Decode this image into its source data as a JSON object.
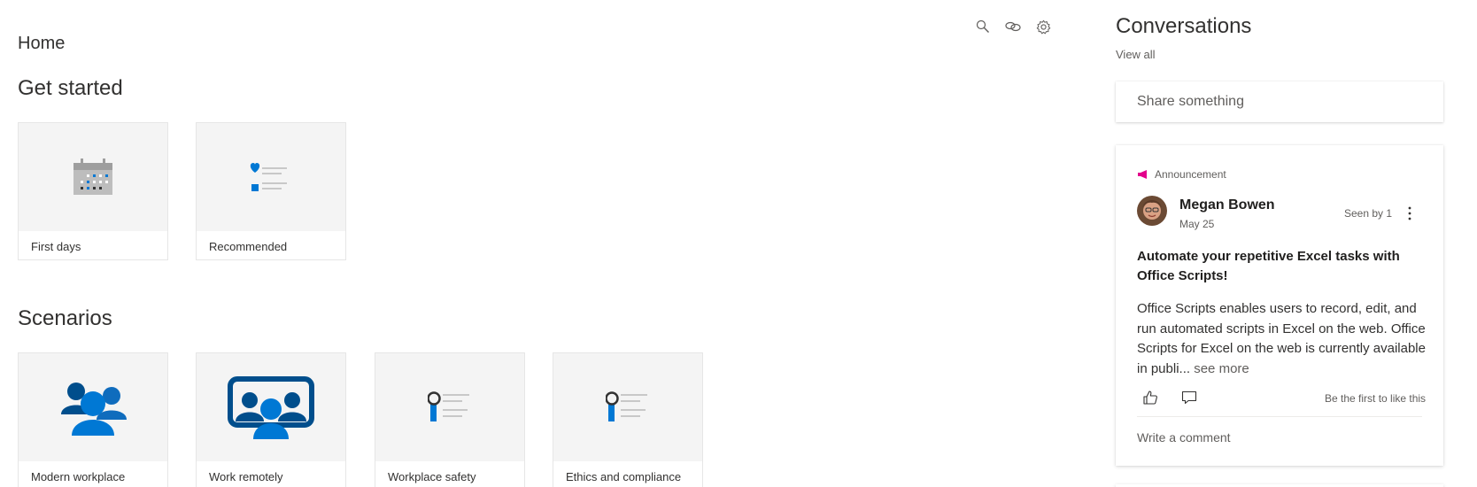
{
  "page": {
    "title": "Home"
  },
  "toolbar": {
    "icons": [
      "search-icon",
      "link-icon",
      "settings-icon"
    ]
  },
  "get_started": {
    "heading": "Get started",
    "tiles": [
      {
        "label": "First days",
        "icon": "calendar-icon"
      },
      {
        "label": "Recommended",
        "icon": "recommended-list-icon"
      }
    ]
  },
  "scenarios": {
    "heading": "Scenarios",
    "tiles": [
      {
        "label": "Modern workplace",
        "icon": "people-group-icon"
      },
      {
        "label": "Work remotely",
        "icon": "remote-meeting-icon"
      },
      {
        "label": "Workplace safety",
        "icon": "award-list-icon"
      },
      {
        "label": "Ethics and compliance",
        "icon": "award-list-icon"
      }
    ]
  },
  "conversations": {
    "heading": "Conversations",
    "view_all": "View all",
    "share_placeholder": "Share something",
    "post": {
      "tag": "Announcement",
      "author": "Megan Bowen",
      "date": "May 25",
      "seen": "Seen by 1",
      "title": "Automate your repetitive Excel tasks with Office Scripts!",
      "body": "Office Scripts enables users to record, edit, and run automated scripts in Excel on the web. Office Scripts for Excel on the web is currently available in publi...",
      "see_more": "see more",
      "likes_text": "Be the first to like this",
      "write_comment": "Write a comment"
    }
  },
  "colors": {
    "accent": "#0078d4",
    "accent_dark": "#004e8c",
    "announcement": "#e3008c",
    "tile_bg": "#f4f4f4"
  }
}
